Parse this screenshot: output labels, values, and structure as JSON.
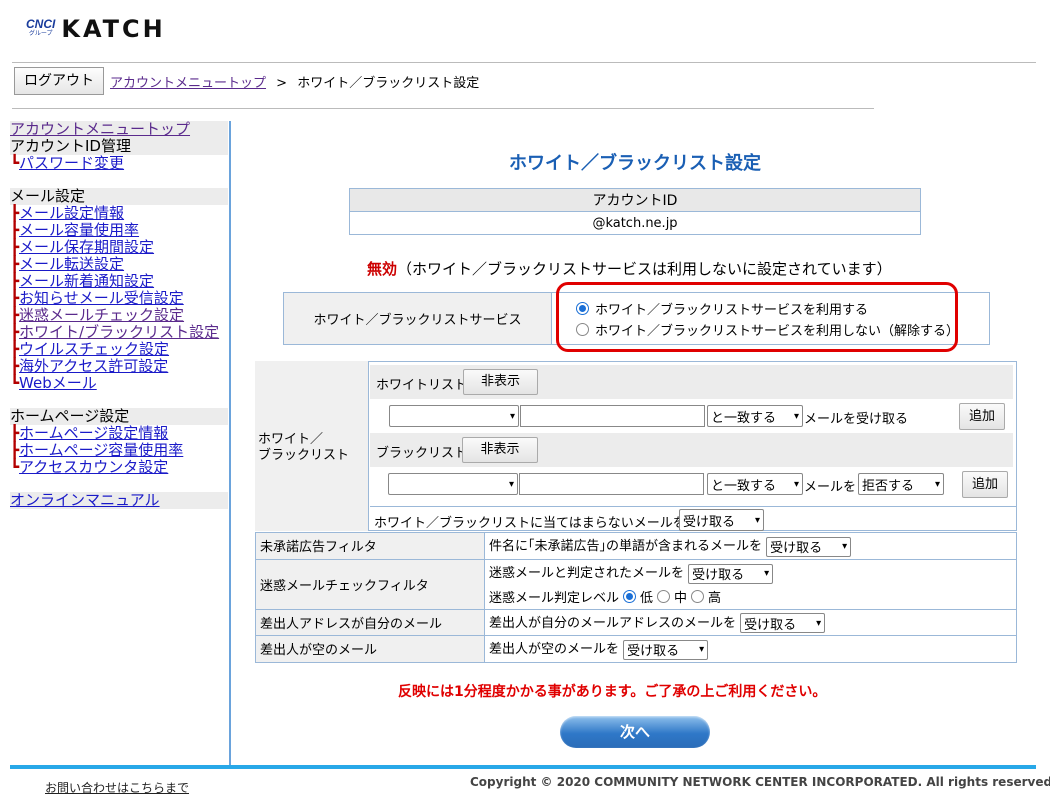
{
  "header": {
    "brand_small": "CNCI",
    "brand_sub": "グループ",
    "brand": "KATCH"
  },
  "nav": {
    "logout_label": "ログアウト",
    "crumb_link": "アカウントメニュートップ",
    "crumb_sep": ">",
    "crumb_current": "ホワイト／ブラックリスト設定"
  },
  "sidebar": {
    "top_link": "アカウントメニュートップ",
    "account_head": "アカウントID管理",
    "account_items": [
      "パスワード変更"
    ],
    "mail_head": "メール設定",
    "mail_items": [
      "メール設定情報",
      "メール容量使用率",
      "メール保存期間設定",
      "メール転送設定",
      "メール新着通知設定",
      "お知らせメール受信設定",
      "迷惑メールチェック設定",
      "ホワイト/ブラックリスト設定",
      "ウイルスチェック設定",
      "海外アクセス許可設定",
      "Webメール"
    ],
    "hp_head": "ホームページ設定",
    "hp_items": [
      "ホームページ設定情報",
      "ホームページ容量使用率",
      "アクセスカウンタ設定"
    ],
    "manual_link": "オンラインマニュアル"
  },
  "main": {
    "title": "ホワイト／ブラックリスト設定",
    "account_id_label": "アカウントID",
    "account_id_value": "@katch.ne.jp",
    "status_bad": "無効",
    "status_rest": "（ホワイト／ブラックリストサービスは利用しないに設定されています）",
    "service_label": "ホワイト／ブラックリストサービス",
    "service_on": "ホワイト／ブラックリストサービスを利用する",
    "service_off": "ホワイト／ブラックリストサービスを利用しない（解除する）",
    "wb_label_1": "ホワイト／",
    "wb_label_2": "ブラックリスト",
    "white_label": "ホワイトリスト",
    "black_label": "ブラックリスト",
    "hide_label": "非表示",
    "match_label": "と一致する",
    "white_action": "メールを受け取る",
    "black_action_prefix": "メールを",
    "reject_label": "拒否する",
    "add_label": "追加",
    "unmatched_text": "ホワイト／ブラックリストに当てはまらないメールを",
    "receive_label": "受け取る",
    "rows": {
      "ad_label": "未承諾広告フィルタ",
      "ad_text": "件名に｢未承諾広告｣の単語が含まれるメールを",
      "spam_label": "迷惑メールチェックフィルタ",
      "spam_text": "迷惑メールと判定されたメールを",
      "spam_level_text": "迷惑メール判定レベル",
      "level_low": "低",
      "level_mid": "中",
      "level_high": "高",
      "self_label": "差出人アドレスが自分のメール",
      "self_text": "差出人が自分のメールアドレスのメールを",
      "empty_label": "差出人が空のメール",
      "empty_text": "差出人が空のメールを"
    },
    "notice": "反映には1分程度かかる事があります。ご了承の上ご利用ください。",
    "next_label": "次へ"
  },
  "footer": {
    "contact": "お問い合わせはこちらまで",
    "copyright": "Copyright © 2020 COMMUNITY NETWORK CENTER INCORPORATED. All rights reserved."
  },
  "colors": {
    "accent": "#1a5fb4",
    "alert": "#e00000",
    "border": "#9bb8d8",
    "footer_bar": "#28a8e8"
  }
}
